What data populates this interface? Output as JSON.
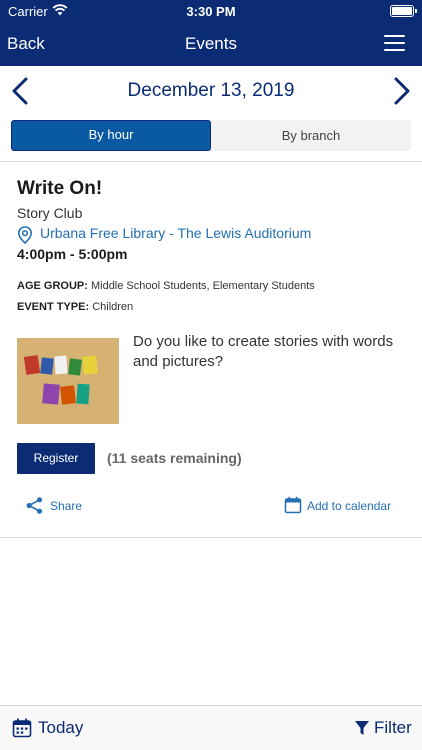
{
  "status_bar": {
    "carrier": "Carrier",
    "time": "3:30 PM"
  },
  "nav": {
    "back_label": "Back",
    "title": "Events"
  },
  "date_header": {
    "date": "December 13, 2019"
  },
  "segmented": {
    "options": [
      "By hour",
      "By branch"
    ],
    "selected": "By hour"
  },
  "event": {
    "title": "Write On!",
    "subtitle": "Story Club",
    "location": "Urbana Free Library - The Lewis Auditorium",
    "time": "4:00pm - 5:00pm",
    "age_group_label": "AGE GROUP:",
    "age_group_value": "Middle School Students, Elementary Students",
    "event_type_label": "EVENT TYPE:",
    "event_type_value": "Children",
    "description": "Do you like to create stories with words and pictures?",
    "register_label": "Register",
    "seats_text": "(11 seats remaining)",
    "share_label": "Share",
    "calendar_label": "Add to calendar"
  },
  "toolbar": {
    "today_label": "Today",
    "filter_label": "Filter"
  },
  "colors": {
    "navy": "#0b2c74",
    "link_blue": "#2470b5",
    "segment_active": "#0a5aa3"
  },
  "icons": [
    "wifi-icon",
    "battery-icon",
    "menu-icon",
    "chevron-left-icon",
    "chevron-right-icon",
    "location-pin-icon",
    "share-icon",
    "calendar-icon",
    "funnel-icon"
  ]
}
